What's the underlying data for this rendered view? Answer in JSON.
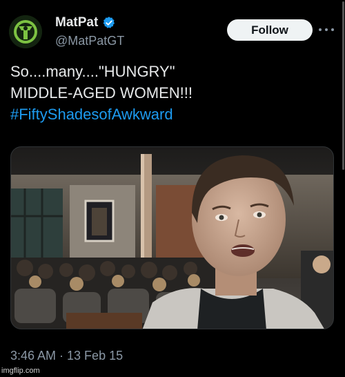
{
  "author": {
    "display_name": "MatPat",
    "handle": "@MatPatGT",
    "verified": true,
    "avatar_icon": "game-theory-logo",
    "avatar_color": "#7cc242"
  },
  "actions": {
    "follow_label": "Follow",
    "more_icon": "more-horizontal-icon"
  },
  "tweet": {
    "lines": [
      "So....many....\"HUNGRY\"",
      "MIDDLE-AGED WOMEN!!!"
    ],
    "hashtag": "#FiftyShadesofAwkward"
  },
  "media": {
    "kind": "photo",
    "description_icon": "selfie-photo"
  },
  "meta": {
    "timestamp": "3:46 AM · 13 Feb 15"
  },
  "watermark": "imgflip.com",
  "colors": {
    "background": "#000000",
    "text": "#e7e9ea",
    "secondary_text": "#8b98a5",
    "link": "#1d9bf0",
    "verified_badge": "#1d9bf0",
    "follow_button_bg": "#eff3f4"
  }
}
